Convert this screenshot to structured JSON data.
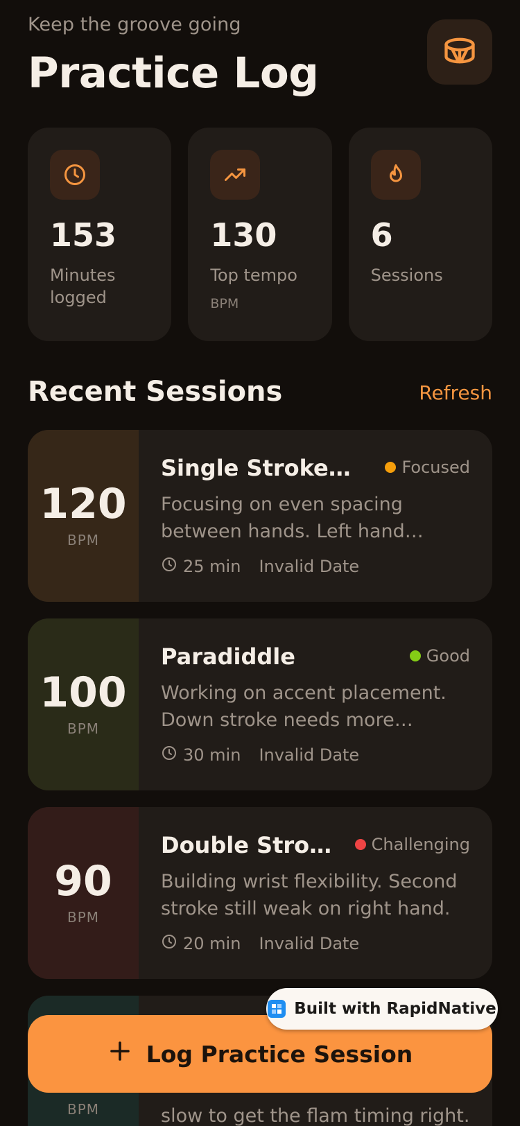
{
  "header": {
    "subtitle": "Keep the groove going",
    "title": "Practice Log",
    "logo_icon": "drum-icon"
  },
  "stats": [
    {
      "icon": "clock-icon",
      "value": "153",
      "label": "Minutes logged",
      "unit": ""
    },
    {
      "icon": "trending-up-icon",
      "value": "130",
      "label": "Top tempo",
      "unit": "BPM"
    },
    {
      "icon": "flame-icon",
      "value": "6",
      "label": "Sessions",
      "unit": ""
    }
  ],
  "section": {
    "title": "Recent Sessions",
    "refresh_label": "Refresh"
  },
  "sessions": [
    {
      "bpm": "120",
      "bpm_unit": "BPM",
      "name": "Single Stroke Roll",
      "status": "Focused",
      "status_color": "#f59e0b",
      "block_color": "#362718",
      "notes": "Focusing on even spacing between hands. Left hand lagging slightly behind.",
      "duration": "25 min",
      "date": "Invalid Date"
    },
    {
      "bpm": "100",
      "bpm_unit": "BPM",
      "name": "Paradiddle",
      "status": "Good",
      "status_color": "#84cc16",
      "block_color": "#2a2b18",
      "notes": "Working on accent placement. Down stroke needs more control.",
      "duration": "30 min",
      "date": "Invalid Date"
    },
    {
      "bpm": "90",
      "bpm_unit": "BPM",
      "name": "Double Stroke Roll",
      "status": "Challenging",
      "status_color": "#ef4444",
      "block_color": "#331c19",
      "notes": "Building wrist flexibility. Second stroke still weak on right hand.",
      "duration": "20 min",
      "date": "Invalid Date"
    },
    {
      "bpm": "",
      "bpm_unit": "BPM",
      "name": "",
      "status": "",
      "status_color": "#10b981",
      "block_color": "#1b2a26",
      "notes": "slow to get the flam timing right.",
      "duration": "",
      "date": ""
    }
  ],
  "fab": {
    "label": "Log Practice Session"
  },
  "badge": {
    "label": "Built with RapidNative"
  },
  "colors": {
    "accent": "#fb9440",
    "background": "#120e0b",
    "card": "#211c18"
  }
}
